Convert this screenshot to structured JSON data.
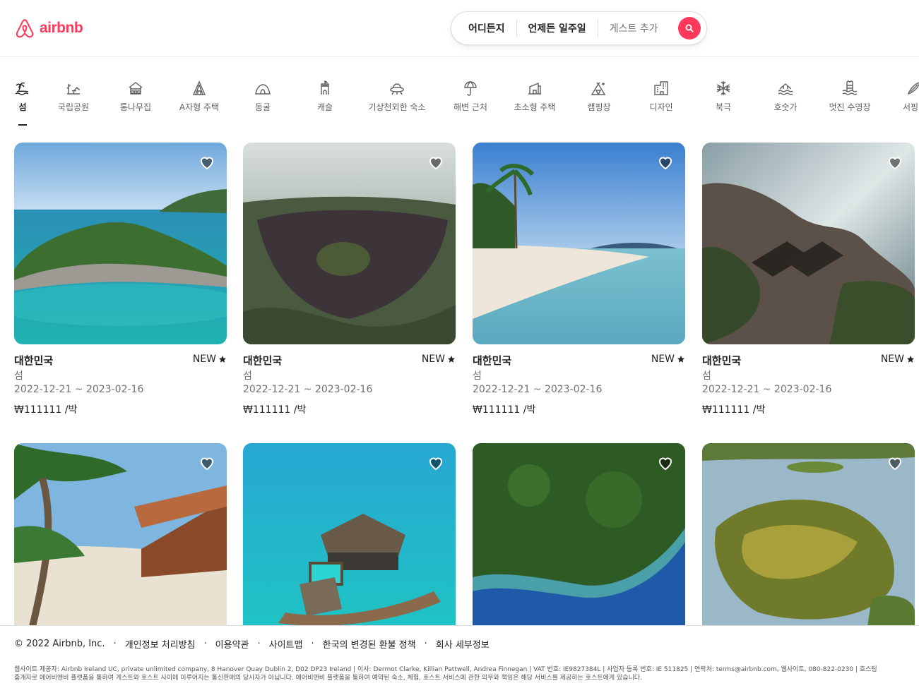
{
  "header": {
    "logo_text": "airbnb",
    "brand_color": "#ff385c",
    "search": {
      "where": "어디든지",
      "when": "언제든 일주일",
      "guests": "게스트 추가",
      "button_icon": "search-icon"
    }
  },
  "categories": [
    {
      "label": "섬",
      "icon": "island-icon",
      "active": true
    },
    {
      "label": "국립공원",
      "icon": "national-park-icon"
    },
    {
      "label": "통나무집",
      "icon": "cabin-icon"
    },
    {
      "label": "A자형 주택",
      "icon": "a-frame-icon"
    },
    {
      "label": "동굴",
      "icon": "cave-icon"
    },
    {
      "label": "캐슬",
      "icon": "castle-icon"
    },
    {
      "label": "기상천외한 숙소",
      "icon": "ufo-icon"
    },
    {
      "label": "해변 근처",
      "icon": "beach-umbrella-icon"
    },
    {
      "label": "초소형 주택",
      "icon": "tiny-home-icon"
    },
    {
      "label": "캠핑장",
      "icon": "camping-icon"
    },
    {
      "label": "디자인",
      "icon": "design-icon"
    },
    {
      "label": "북극",
      "icon": "snowflake-icon"
    },
    {
      "label": "호숫가",
      "icon": "lake-icon"
    },
    {
      "label": "멋진 수영장",
      "icon": "pool-icon"
    },
    {
      "label": "서핑",
      "icon": "surfing-icon"
    }
  ],
  "listings": [
    {
      "location": "대한민국",
      "badge": "NEW",
      "category": "섬",
      "dates": "2022-12-21 ~ 2023-02-16",
      "price": "₩111111 /박"
    },
    {
      "location": "대한민국",
      "badge": "NEW",
      "category": "섬",
      "dates": "2022-12-21 ~ 2023-02-16",
      "price": "₩111111 /박"
    },
    {
      "location": "대한민국",
      "badge": "NEW",
      "category": "섬",
      "dates": "2022-12-21 ~ 2023-02-16",
      "price": "₩111111 /박"
    },
    {
      "location": "대한민국",
      "badge": "NEW",
      "category": "섬",
      "dates": "2022-12-21 ~ 2023-02-16",
      "price": "₩111111 /박"
    },
    {
      "location": "",
      "badge": "",
      "category": "",
      "dates": "",
      "price": ""
    },
    {
      "location": "",
      "badge": "",
      "category": "",
      "dates": "",
      "price": ""
    },
    {
      "location": "",
      "badge": "",
      "category": "",
      "dates": "",
      "price": ""
    },
    {
      "location": "",
      "badge": "",
      "category": "",
      "dates": "",
      "price": ""
    }
  ],
  "footer": {
    "copyright": "© 2022 Airbnb, Inc.",
    "links": [
      "개인정보 처리방침",
      "이용약관",
      "사이트맵",
      "한국의 변경된 환불 정책",
      "회사 세부정보"
    ],
    "legal_line1": "웹사이트 제공자: Airbnb Ireland UC, private unlimited company, 8 Hanover Quay Dublin 2, D02 DP23 Ireland | 이사: Dermot Clarke, Killian Pattwell, Andrea Finnegan | VAT 번호: IE9827384L | 사업자 등록 번호: IE 511825 | 연락처: terms@airbnb.com, 웹사이트, 080-822-0230 | 호스팅",
    "legal_line2": "중개자로 에어비앤비 플랫폼을 통하여 게스트와 호스트 사이에 이루어지는 통신판매의 당사자가 아닙니다. 에어비앤비 플랫폼을 통하여 예약된 숙소, 체험, 호스트 서비스에 관한 의무와 책임은 해당 서비스를 제공하는 호스트에게 있습니다."
  }
}
